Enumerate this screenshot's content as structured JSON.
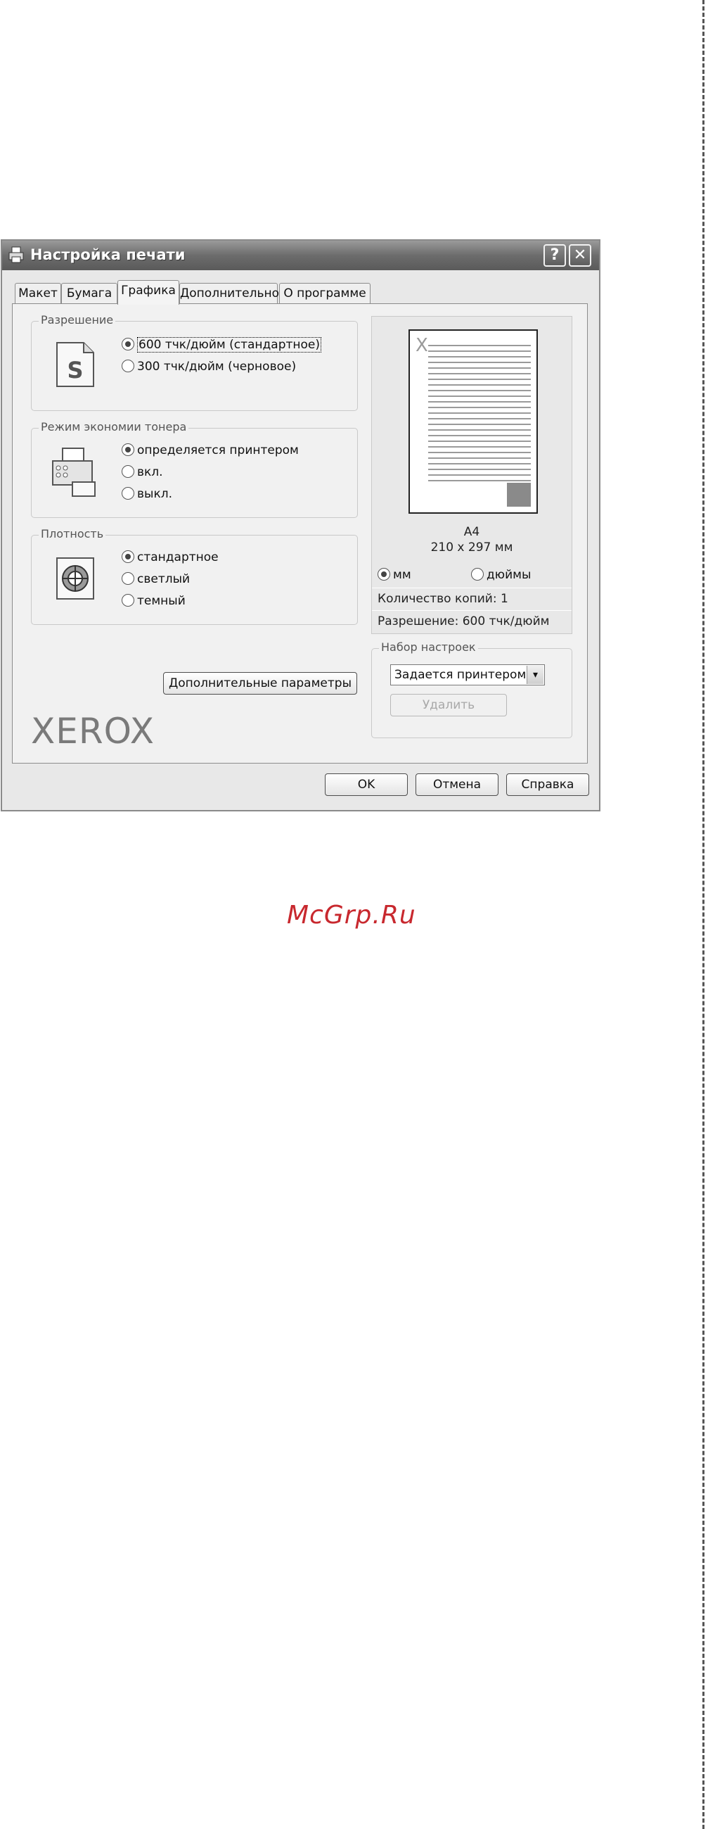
{
  "dialog": {
    "title": "Настройка печати",
    "help_button": "?",
    "close_button": "✕"
  },
  "tabs": [
    {
      "label": "Макет",
      "active": false
    },
    {
      "label": "Бумага",
      "active": false
    },
    {
      "label": "Графика",
      "active": true
    },
    {
      "label": "Дополнительно",
      "active": false
    },
    {
      "label": "О программе",
      "active": false
    }
  ],
  "resolution": {
    "title": "Разрешение",
    "options": [
      {
        "label": "600 тчк/дюйм (стандартное)",
        "selected": true
      },
      {
        "label": "300 тчк/дюйм (черновое)",
        "selected": false
      }
    ]
  },
  "toner_save": {
    "title": "Режим экономии тонера",
    "options": [
      {
        "label": "определяется принтером",
        "selected": true
      },
      {
        "label": "вкл.",
        "selected": false
      },
      {
        "label": "выкл.",
        "selected": false
      }
    ]
  },
  "density": {
    "title": "Плотность",
    "options": [
      {
        "label": "стандартное",
        "selected": true
      },
      {
        "label": "светлый",
        "selected": false
      },
      {
        "label": "темный",
        "selected": false
      }
    ]
  },
  "advanced_button": "Дополнительные параметры",
  "brand_logo": "XEROX",
  "preview": {
    "paper_size": "A4",
    "paper_dims": "210 x 297 мм",
    "unit_mm": "мм",
    "unit_inches": "дюймы",
    "unit_selected": "мм",
    "copies": "Количество копий: 1",
    "resolution": "Разрешение: 600 тчк/дюйм"
  },
  "favorites": {
    "title": "Набор настроек",
    "selected": "Задается принтером",
    "delete_button": "Удалить"
  },
  "footer": {
    "ok": "OK",
    "cancel": "Отмена",
    "help": "Справка"
  },
  "watermark": "McGrp.Ru",
  "colors": {
    "watermark": "#c8282e",
    "titlebar": "#6c6c6c"
  }
}
